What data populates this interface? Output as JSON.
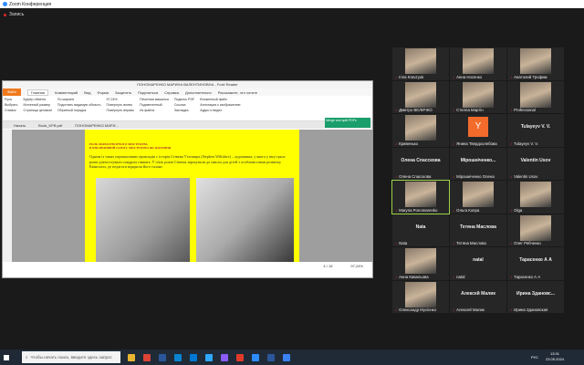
{
  "window": {
    "title": "Zoom Конференция",
    "recording": "Запись"
  },
  "pdf": {
    "title": "ПОНОМАРЕНКО МАРИНА ВАЛЕНТИНОВНА - Foxit Reader",
    "menu": [
      "Файл",
      "Главная",
      "Комментарий",
      "Вид",
      "Форма",
      "Защитить",
      "Поделиться",
      "Справка",
      "Дополнительно",
      "Расскажите, что хотите"
    ],
    "search_placeholder": "Поиск",
    "ribbon": [
      "Рука",
      "Выбрать",
      "Снимок",
      "Буфер обмена",
      "Истинный размер",
      "Страница целиком",
      "По ширине",
      "Подогнать видимую область",
      "Обратный порядок",
      "97,24%",
      "Повернуть влево",
      "Повернуть вправо",
      "Печатная машинка",
      "Подсвеченный",
      "Из файла",
      "Подпись PDF",
      "Ссылка",
      "Закладка",
      "Вложенный файл",
      "Аннотация к изображению",
      "Аудио и видео"
    ],
    "groups": [
      "Утилиты",
      "Вид",
      "Комментарий",
      "Создать",
      "Защитить",
      "Ссылки",
      "Вставка"
    ],
    "tabs": [
      "Начать",
      "Book_KPB.pdf",
      "ПОНОМАРЕНКО МАРИ..."
    ],
    "ad": "Merge and split PDFs",
    "page_heading1": "РОЛЬ ОБРАЗОТВОРЧОГО МИСТЕЦТВА",
    "page_heading2": "В ІНКЛЮЗИВНІЙ ОСВІТІ: МИСТЕЦТВО ЯК ЗЦІЛЕННЯ",
    "page_text": "Одним із таких переконливих прикладів є історія Стівена Уілтшира (Stephen Wiltshire) – художника, у якого у віці трьох років діагностували синдром саванта. У п'ять років Стівена зарахували до школи для дітей з особливостями розвитку Квінсмілл, де педагоги відкрили його талант.",
    "page_nav": "4 / 15",
    "zoom": "97,24%"
  },
  "participants": [
    {
      "name": "Inna Kravzyuk",
      "video": true
    },
    {
      "name": "Анна Носенко",
      "video": true
    },
    {
      "name": "Анатолий Трофим",
      "video": true
    },
    {
      "name": "Дмитро ВЕЛИЧКО",
      "video": true
    },
    {
      "name": "Стелла Мартін",
      "video": true
    },
    {
      "name": "Professional",
      "video": true
    },
    {
      "name": "Кривенько",
      "video": true
    },
    {
      "name": "Янина Твердохлебова",
      "avatar": "Y"
    },
    {
      "name": "Tulayeyv V. V.",
      "big": "Tulayeyv V. V."
    },
    {
      "name": "Олена Спасскова",
      "big": "Олена Спасскова"
    },
    {
      "name": "Мірошніченко Олена",
      "big": "Мірошніченко..."
    },
    {
      "name": "Valentin Usov",
      "big": "Valentin Usov"
    },
    {
      "name": "Maryna Ponomarenko",
      "video": true,
      "active": true
    },
    {
      "name": "Ольга Копра",
      "video": true
    },
    {
      "name": "Olga",
      "video": true
    },
    {
      "name": "Nata",
      "big": "Nata"
    },
    {
      "name": "Тетяна Маслова",
      "big": "Тетяна Маслова"
    },
    {
      "name": "Олег Рябченко",
      "video": true
    },
    {
      "name": "Анна Кавальова",
      "video": true
    },
    {
      "name": "natal",
      "big": "natal"
    },
    {
      "name": "Тарасенко А А",
      "big": "Тарасенко А А"
    },
    {
      "name": "Олександр Мусієнко",
      "video": true
    },
    {
      "name": "Алексей Малик",
      "big": "Алексей Малик"
    },
    {
      "name": "Ирина Здановская",
      "big": "Ирина Здановс..."
    }
  ],
  "taskbar": {
    "search_placeholder": "Чтобы начать поиск, введите здесь запрос",
    "lang": "РУС",
    "time": "13:31",
    "date": "23.05.2024",
    "app_colors": [
      "#e8b530",
      "#db4437",
      "#2b579a",
      "#0a84d0",
      "#0078d4",
      "#31a8ff",
      "#8b5cf6",
      "#e03a2a",
      "#2d8cff",
      "#2b579a",
      "#3b82f6"
    ]
  }
}
